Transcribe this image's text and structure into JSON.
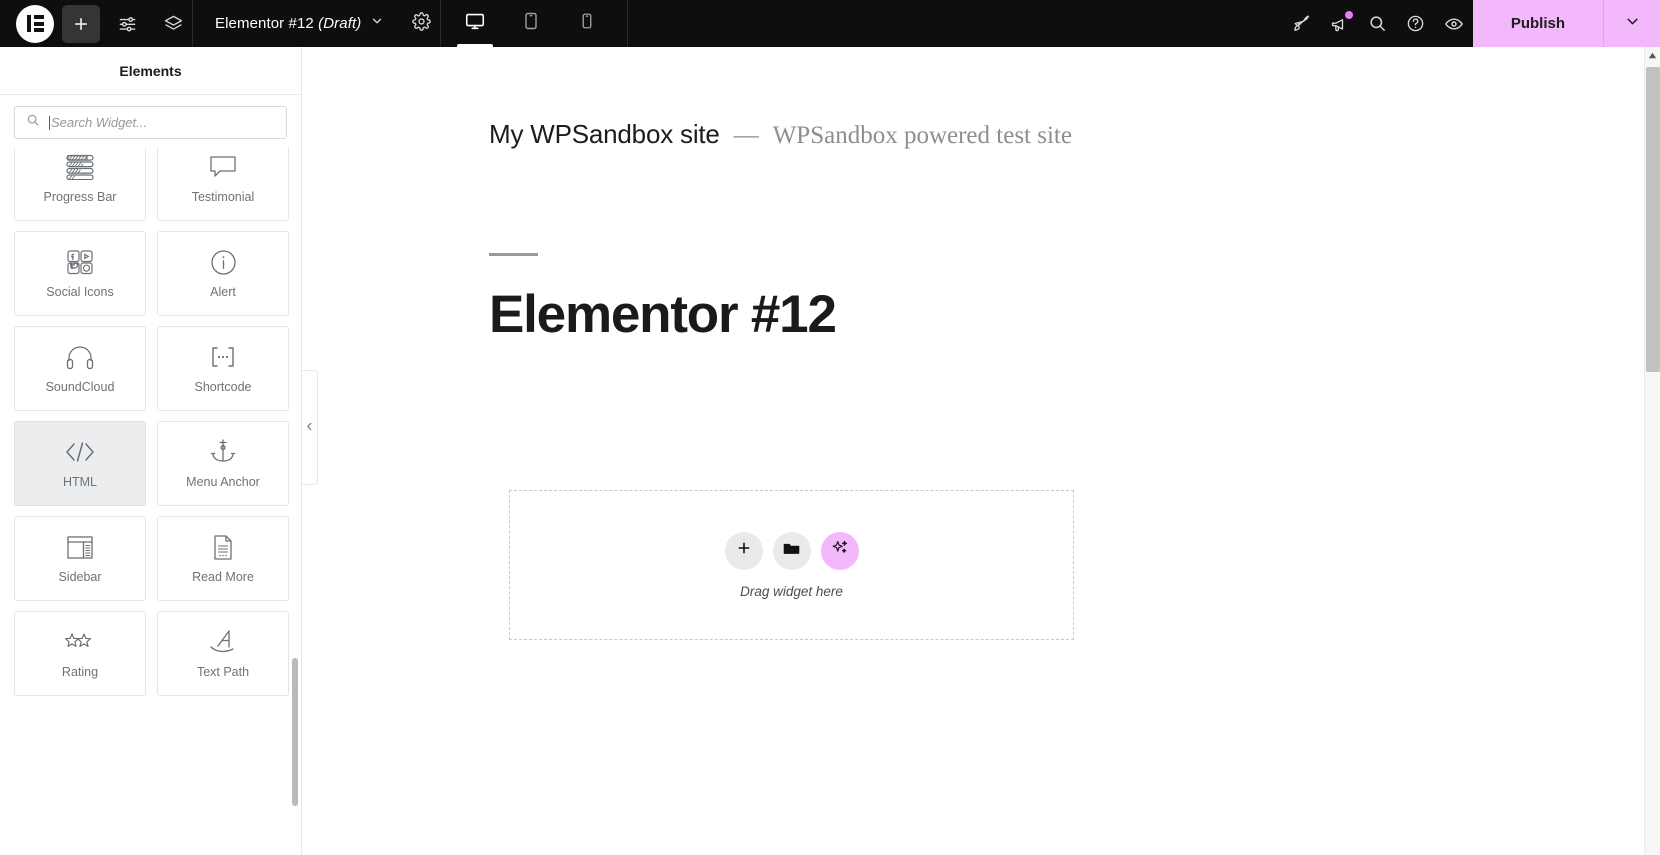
{
  "topbar": {
    "logo_name": "elementor-logo",
    "icons": [
      {
        "name": "add-element-button",
        "title": "Add Element"
      },
      {
        "name": "site-settings-button",
        "title": "Site Settings"
      },
      {
        "name": "structure-layers-button",
        "title": "Navigator"
      }
    ],
    "document_title": "Elementor #12",
    "document_status": "(Draft)",
    "settings_icon": "gear-icon",
    "chevron_icon": "chevron-down-icon",
    "responsive": [
      {
        "name": "desktop-view-button",
        "label": "Desktop",
        "active": true
      },
      {
        "name": "tablet-view-button",
        "label": "Tablet",
        "active": false
      },
      {
        "name": "mobile-view-button",
        "label": "Mobile",
        "active": false
      }
    ],
    "right_icons": [
      {
        "name": "rocket-launch-icon",
        "label": "Finder"
      },
      {
        "name": "megaphone-icon",
        "label": "Notifications",
        "badge": true
      },
      {
        "name": "search-icon",
        "label": "Search"
      },
      {
        "name": "help-icon",
        "label": "Help"
      },
      {
        "name": "preview-eye-icon",
        "label": "Preview Changes"
      }
    ],
    "publish_label": "Publish",
    "publish_chevron": "chevron-down-icon",
    "publish_color": "#f3b7fb",
    "bar_color": "#0e0e0e"
  },
  "panel": {
    "title": "Elements",
    "search": {
      "placeholder": "Search Widget...",
      "value": "",
      "icon": "search-icon"
    },
    "collapse_icon": "chevron-left-icon",
    "widgets": [
      {
        "label": "Progress Bar",
        "icon": "progress-bar-icon",
        "highlight": false
      },
      {
        "label": "Testimonial",
        "icon": "speech-bubble-icon",
        "highlight": false
      },
      {
        "label": "Social Icons",
        "icon": "social-icons-icon",
        "highlight": false
      },
      {
        "label": "Alert",
        "icon": "info-circle-icon",
        "highlight": false
      },
      {
        "label": "SoundCloud",
        "icon": "headphones-icon",
        "highlight": false
      },
      {
        "label": "Shortcode",
        "icon": "shortcode-brackets-icon",
        "highlight": false
      },
      {
        "label": "HTML",
        "icon": "code-tags-icon",
        "highlight": true
      },
      {
        "label": "Menu Anchor",
        "icon": "anchor-icon",
        "highlight": false
      },
      {
        "label": "Sidebar",
        "icon": "sidebar-layout-icon",
        "highlight": false
      },
      {
        "label": "Read More",
        "icon": "document-page-icon",
        "highlight": false
      },
      {
        "label": "Rating",
        "icon": "stars-icon",
        "highlight": false
      },
      {
        "label": "Text Path",
        "icon": "text-path-icon",
        "highlight": false
      }
    ]
  },
  "canvas": {
    "site_title": "My WPSandbox site",
    "site_separator": "—",
    "site_tagline": "WPSandbox powered test site",
    "page_heading": "Elementor #12",
    "dropzone": {
      "label": "Drag widget here",
      "buttons": [
        {
          "name": "add-widget-button",
          "icon": "plus-icon"
        },
        {
          "name": "add-template-button",
          "icon": "folder-icon"
        },
        {
          "name": "ai-generate-button",
          "icon": "sparkles-icon"
        }
      ]
    }
  }
}
